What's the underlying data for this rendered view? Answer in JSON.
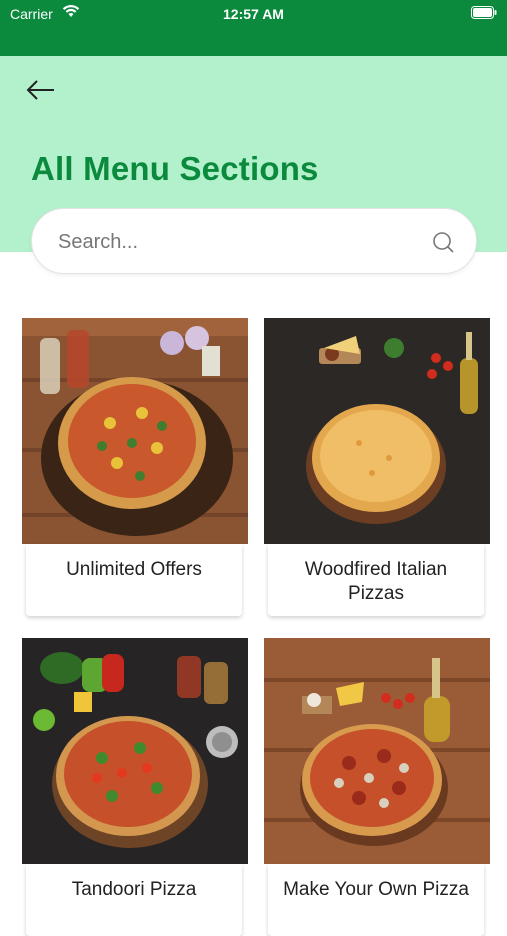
{
  "status": {
    "carrier": "Carrier",
    "time": "12:57 AM"
  },
  "header": {
    "title": "All Menu Sections"
  },
  "search": {
    "placeholder": "Search..."
  },
  "sections": [
    {
      "label": "Unlimited Offers",
      "image": "pizza-on-wood-board-photo"
    },
    {
      "label": "Woodfired Italian Pizzas",
      "image": "cheese-pizza-on-dark-table-photo"
    },
    {
      "label": "Tandoori Pizza",
      "image": "tandoori-pizza-with-peppers-photo"
    },
    {
      "label": "Make Your Own Pizza",
      "image": "pepperoni-mushroom-pizza-photo"
    }
  ],
  "colors": {
    "status_bar": "#0b8a3e",
    "header_bg": "#b3f1cc",
    "title": "#0b8a3e"
  }
}
